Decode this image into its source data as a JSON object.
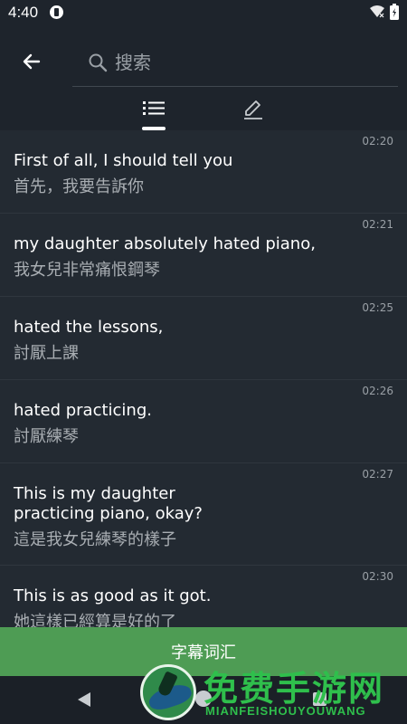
{
  "status_bar": {
    "time": "4:40"
  },
  "search": {
    "placeholder": "搜索"
  },
  "tabs": [
    {
      "name": "list",
      "icon": "list-icon",
      "selected": true
    },
    {
      "name": "edit",
      "icon": "edit-icon",
      "selected": false
    }
  ],
  "subtitles": [
    {
      "time": "02:20",
      "en": "First of all, I should tell you",
      "zh": "首先，我要告訴你"
    },
    {
      "time": "02:21",
      "en": "my daughter absolutely hated piano,",
      "zh": "我女兒非常痛恨鋼琴"
    },
    {
      "time": "02:25",
      "en": "hated the lessons,",
      "zh": "討厭上課"
    },
    {
      "time": "02:26",
      "en": "hated practicing.",
      "zh": "討厭練琴"
    },
    {
      "time": "02:27",
      "en": "This is my daughter\npracticing piano, okay?",
      "zh": "這是我女兒練琴的樣子"
    },
    {
      "time": "02:30",
      "en": "This is as good as it got.",
      "zh": "她這樣已經算是好的了"
    }
  ],
  "bottom_button": {
    "label": "字幕词汇"
  },
  "watermark": {
    "title": "免费手游网",
    "subtitle": "MIANFEISHOUYOUWANG"
  },
  "colors": {
    "background": "#1d232a",
    "list_background": "#232a32",
    "accent_green": "#4e9c54",
    "secondary_text": "#a9aeb3"
  }
}
